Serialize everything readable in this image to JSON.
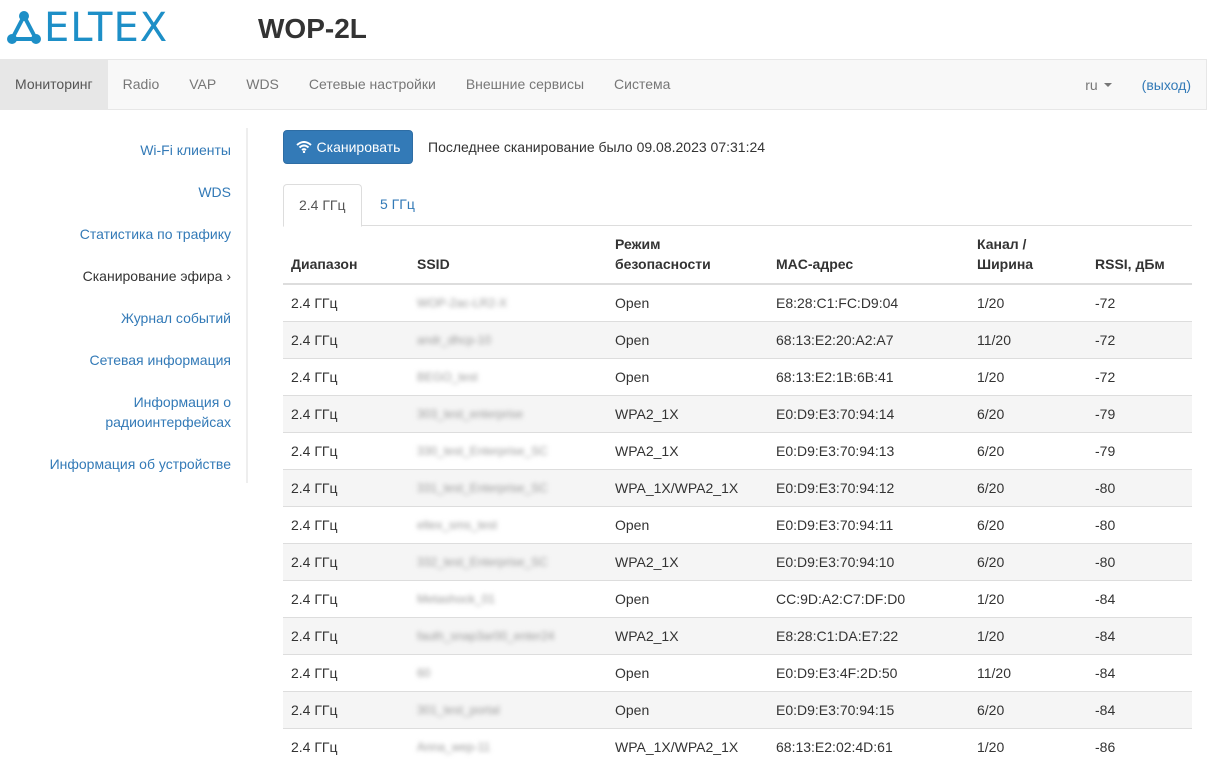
{
  "header": {
    "logo_text": "ELTEX",
    "device_title": "WOP-2L"
  },
  "nav": {
    "items": [
      "Мониторинг",
      "Radio",
      "VAP",
      "WDS",
      "Сетевые настройки",
      "Внешние сервисы",
      "Система"
    ],
    "active": "Мониторинг",
    "language": "ru",
    "logout_label": "(выход)"
  },
  "sidebar": {
    "items": [
      "Wi-Fi клиенты",
      "WDS",
      "Статистика по трафику",
      "Сканирование эфира ›",
      "Журнал событий",
      "Сетевая информация",
      "Информация о",
      "радиоинтерфейсах",
      "Информация об устройстве"
    ]
  },
  "scan": {
    "button_label": "Сканировать",
    "last_scan_text": "Последнее сканирование было 09.08.2023 07:31:24"
  },
  "tabs": [
    "2.4 ГГц",
    "5 ГГц"
  ],
  "table": {
    "headers": {
      "band": "Диапазон",
      "ssid": "SSID",
      "security_1": "Режим",
      "security_2": "безопасности",
      "mac": "MAC-адрес",
      "channel_1": "Канал /",
      "channel_2": "Ширина",
      "rssi": "RSSI, дБм"
    },
    "rows": [
      {
        "band": "2.4 ГГц",
        "ssid": "WOP-2ac-LR2-X",
        "security": "Open",
        "mac": "E8:28:C1:FC:D9:04",
        "channel": "1/20",
        "rssi": "-72"
      },
      {
        "band": "2.4 ГГц",
        "ssid": "andr_dhcp-10",
        "security": "Open",
        "mac": "68:13:E2:20:A2:A7",
        "channel": "11/20",
        "rssi": "-72"
      },
      {
        "band": "2.4 ГГц",
        "ssid": "BEGO_test",
        "security": "Open",
        "mac": "68:13:E2:1B:6B:41",
        "channel": "1/20",
        "rssi": "-72"
      },
      {
        "band": "2.4 ГГц",
        "ssid": "303_test_enterprise",
        "security": "WPA2_1X",
        "mac": "E0:D9:E3:70:94:14",
        "channel": "6/20",
        "rssi": "-79"
      },
      {
        "band": "2.4 ГГц",
        "ssid": "330_test_Enterprise_SC",
        "security": "WPA2_1X",
        "mac": "E0:D9:E3:70:94:13",
        "channel": "6/20",
        "rssi": "-79"
      },
      {
        "band": "2.4 ГГц",
        "ssid": "331_test_Enterprise_SC",
        "security": "WPA_1X/WPA2_1X",
        "mac": "E0:D9:E3:70:94:12",
        "channel": "6/20",
        "rssi": "-80"
      },
      {
        "band": "2.4 ГГц",
        "ssid": "eltex_sms_test",
        "security": "Open",
        "mac": "E0:D9:E3:70:94:11",
        "channel": "6/20",
        "rssi": "-80"
      },
      {
        "band": "2.4 ГГц",
        "ssid": "332_test_Enterprise_SC",
        "security": "WPA2_1X",
        "mac": "E0:D9:E3:70:94:10",
        "channel": "6/20",
        "rssi": "-80"
      },
      {
        "band": "2.4 ГГц",
        "ssid": "Metashock_01",
        "security": "Open",
        "mac": "CC:9D:A2:C7:DF:D0",
        "channel": "1/20",
        "rssi": "-84"
      },
      {
        "band": "2.4 ГГц",
        "ssid": "fauth_snap3ar00_enter24",
        "security": "WPA2_1X",
        "mac": "E8:28:C1:DA:E7:22",
        "channel": "1/20",
        "rssi": "-84"
      },
      {
        "band": "2.4 ГГц",
        "ssid": "60",
        "security": "Open",
        "mac": "E0:D9:E3:4F:2D:50",
        "channel": "11/20",
        "rssi": "-84"
      },
      {
        "band": "2.4 ГГц",
        "ssid": "301_test_portal",
        "security": "Open",
        "mac": "E0:D9:E3:70:94:15",
        "channel": "6/20",
        "rssi": "-84"
      },
      {
        "band": "2.4 ГГц",
        "ssid": "Anna_wep-11",
        "security": "WPA_1X/WPA2_1X",
        "mac": "68:13:E2:02:4D:61",
        "channel": "1/20",
        "rssi": "-86"
      }
    ]
  },
  "colors": {
    "brand": "#1d8fc7",
    "link": "#337ab7",
    "button": "#337ab7",
    "navbar_bg": "#f8f8f8",
    "nav_active_bg": "#e7e7e7"
  }
}
